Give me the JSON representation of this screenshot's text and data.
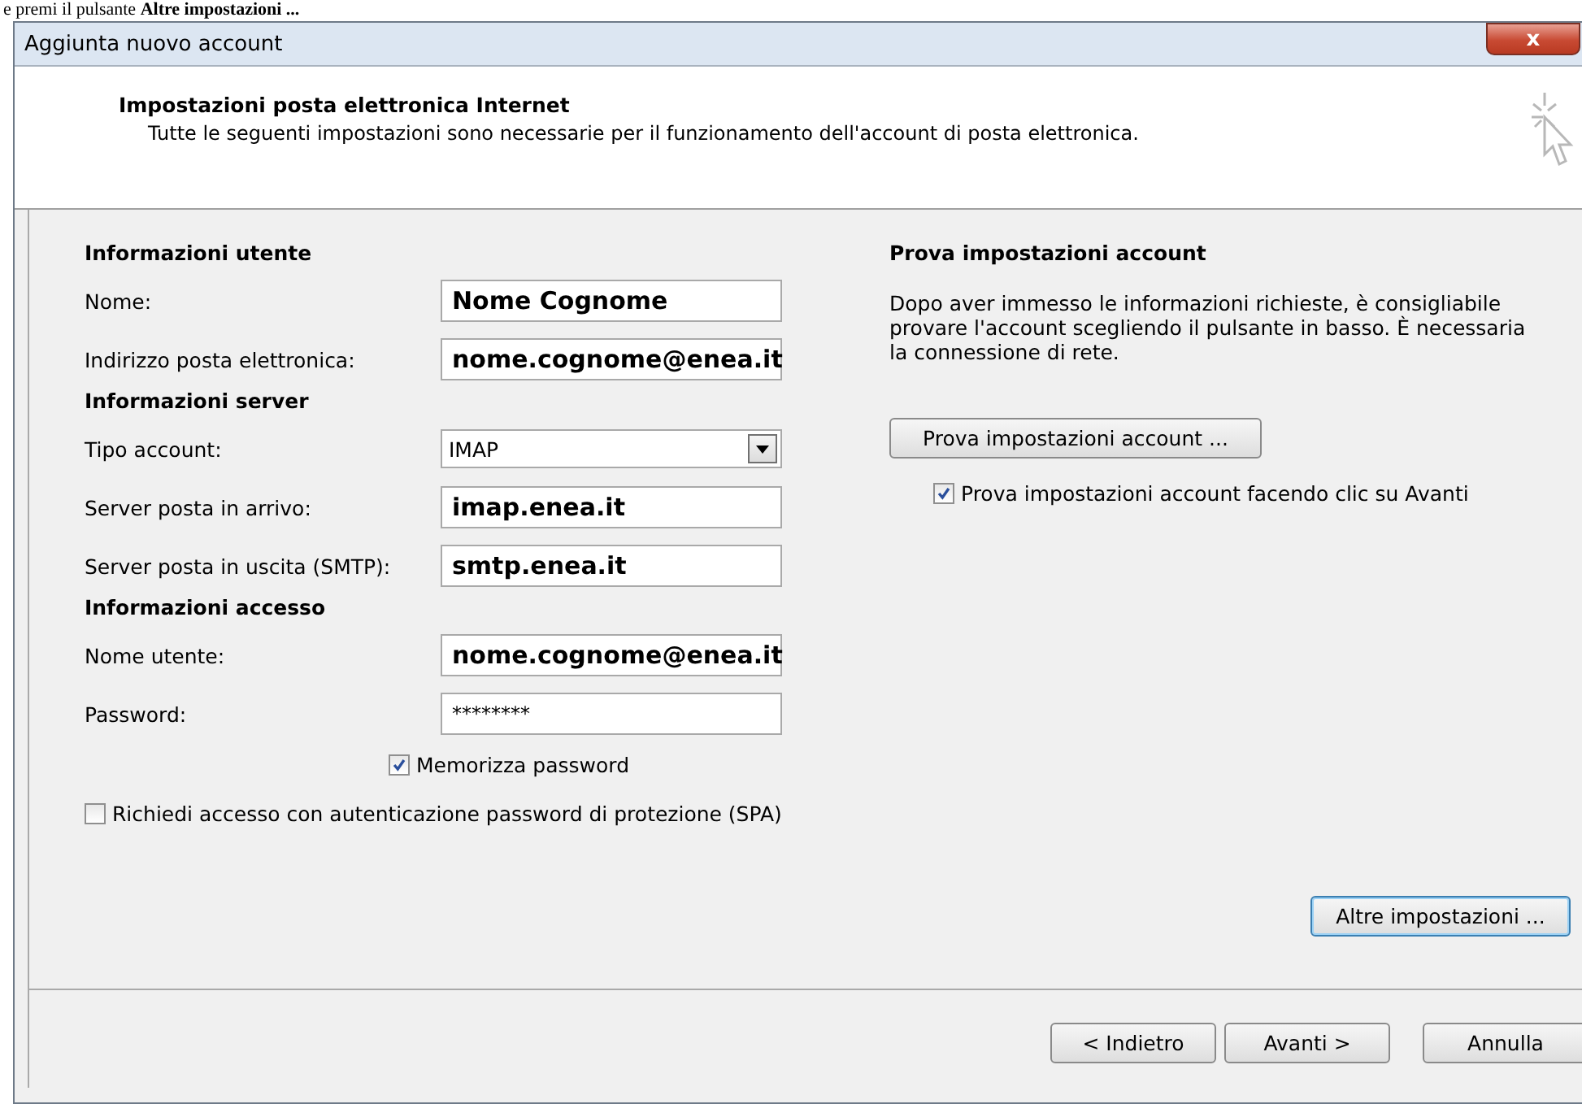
{
  "document_text": "e premi il pulsante **Altre impostazioni ...**",
  "window": {
    "title": "Aggiunta nuovo account",
    "close": "x"
  },
  "header": {
    "title": "Impostazioni posta elettronica Internet",
    "subtitle": "Tutte le seguenti impostazioni sono necessarie per il funzionamento dell'account di posta elettronica."
  },
  "left": [
    {
      "kind": "heading",
      "text": "Informazioni utente"
    },
    {
      "kind": "text",
      "label": "Nome:",
      "value": "Nome Cognome"
    },
    {
      "kind": "text",
      "label": "Indirizzo posta elettronica:",
      "value": "nome.cognome@enea.it"
    },
    {
      "kind": "heading",
      "text": "Informazioni server"
    },
    {
      "kind": "select",
      "label": "Tipo account:",
      "value": "IMAP"
    },
    {
      "kind": "text",
      "label": "Server posta in arrivo:",
      "value": "imap.enea.it"
    },
    {
      "kind": "text",
      "label": "Server posta in uscita (SMTP):",
      "value": "smtp.enea.it"
    },
    {
      "kind": "heading",
      "text": "Informazioni accesso"
    },
    {
      "kind": "text",
      "label": "Nome utente:",
      "value": "nome.cognome@enea.it"
    },
    {
      "kind": "password",
      "label": "Password:",
      "value": "********"
    },
    {
      "kind": "check",
      "label": "Memorizza password",
      "checked": true
    },
    {
      "kind": "check_wide",
      "label": "Richiedi accesso con autenticazione password di protezione (SPA)",
      "checked": false
    }
  ],
  "right": {
    "heading": "Prova impostazioni account",
    "description": "Dopo aver immesso le informazioni richieste, è consigliabile provare l'account scegliendo il pulsante in basso. È necessaria la connessione di rete.",
    "test_button": "Prova impostazioni account ...",
    "test_check": {
      "label": "Prova impostazioni account facendo clic su Avanti",
      "checked": true
    },
    "more_button": "Altre impostazioni ..."
  },
  "buttons": [
    "< Indietro",
    "Avanti >",
    "Annulla"
  ]
}
